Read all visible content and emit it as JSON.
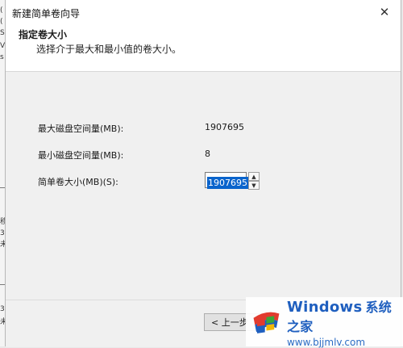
{
  "background": {
    "fragments": [
      "(",
      "(",
      "S",
      "V",
      "s",
      "移",
      "3",
      "未",
      "3",
      "未"
    ]
  },
  "dialog": {
    "title": "新建简单卷向导",
    "header_title": "指定卷大小",
    "header_subtitle": "选择介于最大和最小值的卷大小。",
    "max_label": "最大磁盘空间量(MB):",
    "max_value": "1907695",
    "min_label": "最小磁盘空间量(MB):",
    "min_value": "8",
    "size_label": "简单卷大小(MB)(S):",
    "size_value": "1907695",
    "back_button": "< 上一步"
  },
  "watermark": {
    "brand": "Windows",
    "brand_cn": "系统之家",
    "url": "www.bjjmlv.com",
    "colors": {
      "blue": "#1f5fbf",
      "red": "#e23b2e",
      "green": "#3aa63a",
      "yellow": "#f2b705"
    }
  },
  "icons": [
    "close-icon",
    "spin-up-icon",
    "spin-down-icon",
    "windows-logo-icon"
  ]
}
